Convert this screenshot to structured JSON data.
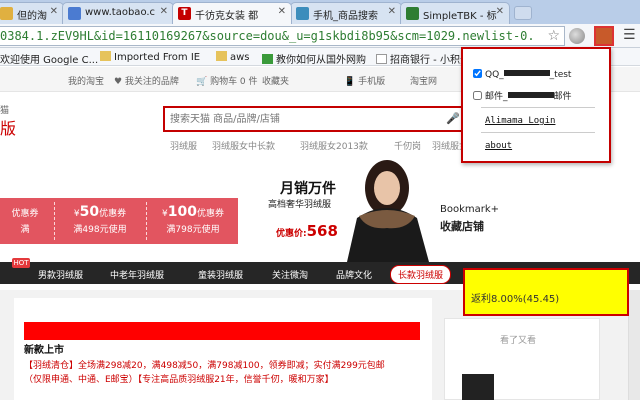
{
  "browser": {
    "tabs": [
      {
        "title": "但的淘",
        "icon_color": "#e0b040"
      },
      {
        "title": "www.taobao.c",
        "icon_color": "#4b7bd1"
      },
      {
        "title": "千彷克女装 都",
        "icon_color": "#c40000",
        "icon_glyph": "T"
      },
      {
        "title": "手机_商品搜索",
        "icon_color": "#3c8dbc"
      },
      {
        "title": "SimpleTBK - 标",
        "icon_color": "#2e7d32"
      }
    ],
    "url": "0384.1.zEV9HL&id=16110169267&source=dou&_u=g1skbdi8b95&scm=1029.newlist-0.",
    "bookmarks": [
      "欢迎使用 Google C...",
      "Imported From IE",
      "aws",
      "教你如何从国外网购",
      "招商银行 - 小积分"
    ]
  },
  "topnav": {
    "my_taobao": "我的淘宝",
    "my_brand": "♥ 我关注的品牌",
    "cart": "🛒 购物车 0 件",
    "favorites": "收藏夹",
    "mobile": "📱 手机版",
    "taobao": "淘宝网"
  },
  "header": {
    "logo_frag": "猫",
    "logo_big": "版",
    "search_placeholder": "搜索天猫 商品/品牌/店铺",
    "hot_terms": [
      "羽绒服",
      "羽绒服女中长款",
      "羽绒服女2013款",
      "千仞岗",
      "羽绒服女"
    ]
  },
  "coupons": [
    {
      "amount": "优惠券",
      "cond": "满"
    },
    {
      "amount": "50",
      "prefix": "¥",
      "suffix": "优惠券",
      "cond": "满498元使用"
    },
    {
      "amount": "100",
      "prefix": "¥",
      "suffix": "优惠券",
      "cond": "满798元使用"
    }
  ],
  "promo": {
    "title": "月销万件",
    "subtitle": "高档奢华羽绒服",
    "price_label": "优惠价:",
    "price": "568",
    "bookmark": "Bookmark+",
    "store": "收藏店铺"
  },
  "categories": [
    {
      "label": "男款羽绒服"
    },
    {
      "label": "中老年羽绒服"
    },
    {
      "label": "童装羽绒服"
    },
    {
      "label": "关注微淘"
    },
    {
      "label": "品牌文化"
    },
    {
      "label": "长款羽绒服"
    }
  ],
  "hot_badge": "HOT",
  "product": {
    "title": "新款上市",
    "desc1": "【羽绒清仓】全场满298减20，满498减50，满798减100，领券即减；实付满299元包邮",
    "desc2": "（仅限申通、中通、E邮宝）【专注高品质羽绒服21年，信誉千仞，暖和万家】",
    "side_title": "看了又看"
  },
  "rebate": {
    "text": "返利8.00%(45.45)"
  },
  "popup": {
    "account1_prefix": "QQ_",
    "account1_suffix": "_test",
    "account1_checked": true,
    "account2_prefix": "邮件_",
    "account2_suffix": "邮件",
    "account2_checked": false,
    "login_link": "Alimama Login",
    "about_link": "about"
  }
}
